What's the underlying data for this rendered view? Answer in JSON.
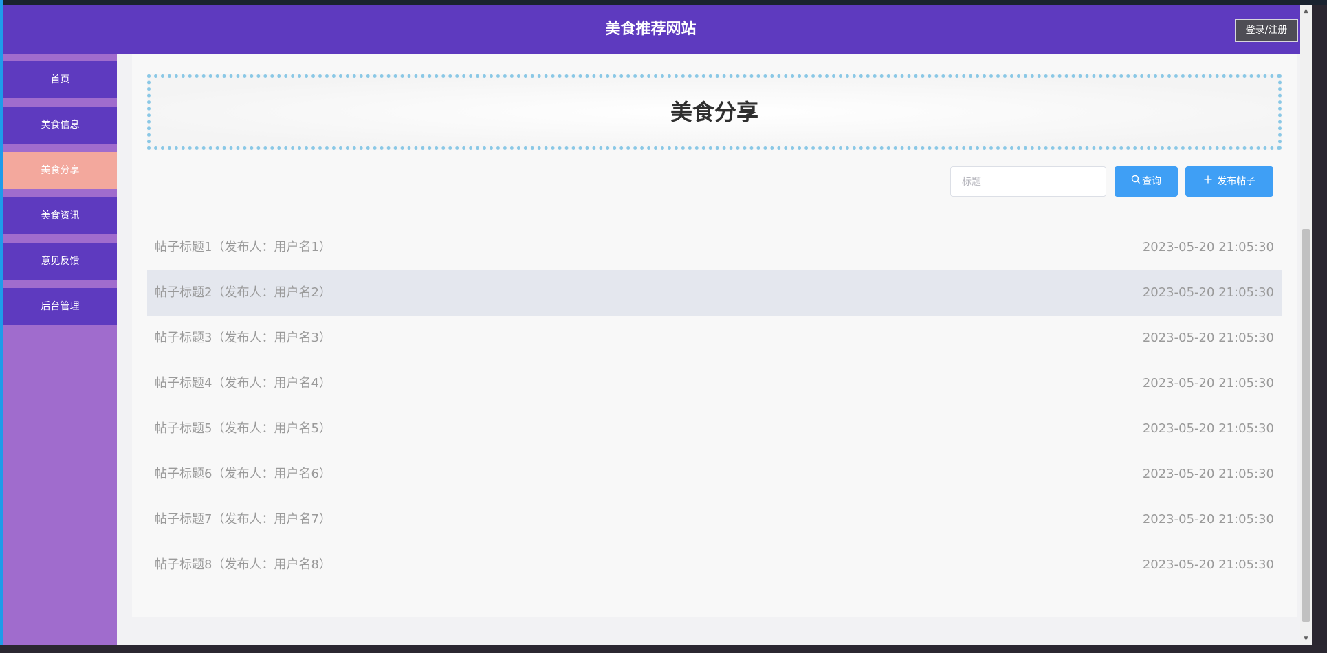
{
  "header": {
    "site_title": "美食推荐网站",
    "login_label": "登录/注册"
  },
  "sidebar": {
    "items": [
      {
        "label": "首页",
        "active": false
      },
      {
        "label": "美食信息",
        "active": false
      },
      {
        "label": "美食分享",
        "active": true
      },
      {
        "label": "美食资讯",
        "active": false
      },
      {
        "label": "意见反馈",
        "active": false
      },
      {
        "label": "后台管理",
        "active": false
      }
    ]
  },
  "main": {
    "banner_title": "美食分享",
    "search": {
      "placeholder": "标题",
      "value": ""
    },
    "query_label": "查询",
    "publish_label": "发布帖子",
    "posts": [
      {
        "title": "帖子标题1（发布人：用户名1）",
        "time": "2023-05-20 21:05:30"
      },
      {
        "title": "帖子标题2（发布人：用户名2）",
        "time": "2023-05-20 21:05:30"
      },
      {
        "title": "帖子标题3（发布人：用户名3）",
        "time": "2023-05-20 21:05:30"
      },
      {
        "title": "帖子标题4（发布人：用户名4）",
        "time": "2023-05-20 21:05:30"
      },
      {
        "title": "帖子标题5（发布人：用户名5）",
        "time": "2023-05-20 21:05:30"
      },
      {
        "title": "帖子标题6（发布人：用户名6）",
        "time": "2023-05-20 21:05:30"
      },
      {
        "title": "帖子标题7（发布人：用户名7）",
        "time": "2023-05-20 21:05:30"
      },
      {
        "title": "帖子标题8（发布人：用户名8）",
        "time": "2023-05-20 21:05:30"
      }
    ]
  },
  "colors": {
    "header_bg": "#5e3abf",
    "sidebar_bg": "#a06ccd",
    "nav_item_bg": "#5e3abf",
    "nav_active_bg": "#f3a89d",
    "button_blue": "#3f9ff5",
    "banner_border": "#8ac8e6",
    "row_hover_bg": "#e4e7ee"
  },
  "icons": {
    "query": "search-icon",
    "publish": "plus-icon"
  }
}
